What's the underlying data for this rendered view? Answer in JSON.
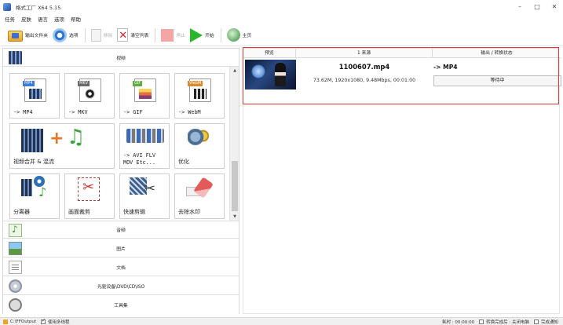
{
  "window": {
    "title": "格式工厂 X64 5.15",
    "controls": [
      "–",
      "□",
      "✕"
    ]
  },
  "menu": [
    "任务",
    "皮肤",
    "语言",
    "选项",
    "帮助"
  ],
  "toolbar": {
    "output_folder": "输出文件夹",
    "options": "选项",
    "remove": "移除",
    "clear_list": "清空列表",
    "stop": "停止",
    "start": "开始",
    "home": "主页"
  },
  "left_panel": {
    "categories": {
      "video": "视频",
      "audio": "音频",
      "image": "图片",
      "document": "文档",
      "disc": "光驱设备\\DVD\\CD\\ISO",
      "tools": "工具集"
    },
    "tiles": [
      {
        "label": "-> MP4",
        "tag": "MP4",
        "tag_color": "#3b7bd3"
      },
      {
        "label": "-> MKV",
        "tag": "MKV",
        "tag_color": "#6b6b6b"
      },
      {
        "label": "-> GIF",
        "tag": "GIF",
        "tag_color": "#5aae3e"
      },
      {
        "label": "-> WebM",
        "tag": "WebM",
        "tag_color": "#d98a2b"
      },
      {
        "label": "视频合并 & 混流"
      },
      {
        "label": "-> AVI FLV",
        "label2": "MOV Etc..."
      },
      {
        "label": "优化"
      },
      {
        "label": "分离器"
      },
      {
        "label": "画面裁剪"
      },
      {
        "label": "快速剪辑"
      },
      {
        "label": "去除水印"
      }
    ]
  },
  "file_list": {
    "headers": [
      "预览",
      "1 来源",
      "输出 / 转换状态"
    ],
    "rows": [
      {
        "name": "1100607.mp4",
        "meta": "73.62M, 1920x1080, 9.48Mbps, 00:01:00",
        "output": "-> MP4",
        "status": "等待中"
      }
    ]
  },
  "statusbar": {
    "output_path": "C:\\FFOutput",
    "multithread": "使用多线程",
    "elapsed": "耗时 : 00:00:00",
    "after_convert": "转换完成后 : 关闭电脑",
    "notify": "完成通知"
  }
}
